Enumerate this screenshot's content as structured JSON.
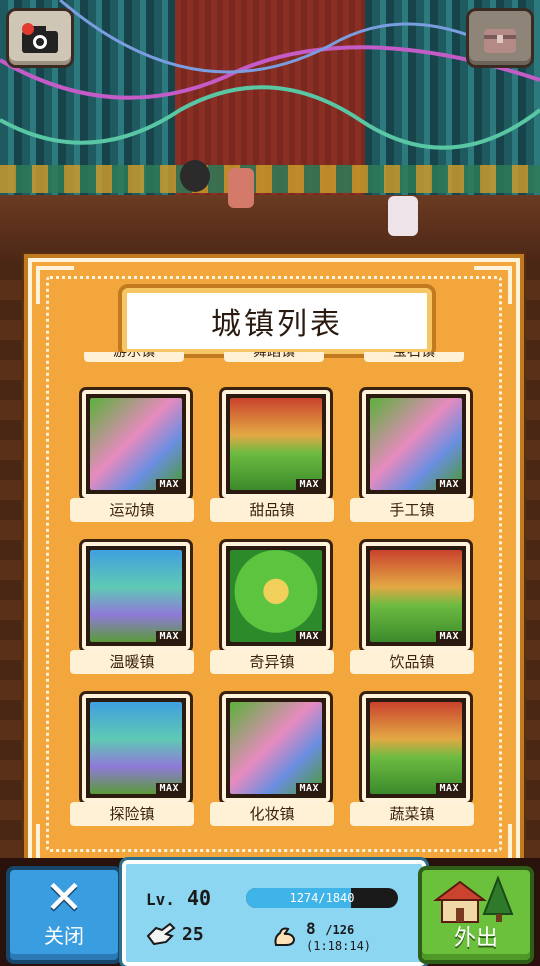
{
  "header": {
    "camera_button_icon": "camera-icon",
    "chest_button_icon": "treasure-chest-icon"
  },
  "panel": {
    "title": "城镇列表",
    "cut_off_row": [
      "游乐镇",
      "舞蹈镇",
      "宝石镇"
    ],
    "max_badge": "MAX",
    "towns": [
      {
        "name": "运动镇",
        "theme": "sports-town",
        "max": true
      },
      {
        "name": "甜品镇",
        "theme": "dessert-town",
        "max": true
      },
      {
        "name": "手工镇",
        "theme": "craft-town",
        "max": true
      },
      {
        "name": "温暖镇",
        "theme": "warm-town",
        "max": true
      },
      {
        "name": "奇异镇",
        "theme": "strange-town",
        "max": true
      },
      {
        "name": "饮品镇",
        "theme": "drinks-town",
        "max": true
      },
      {
        "name": "探险镇",
        "theme": "adventure-town",
        "max": true
      },
      {
        "name": "化妆镇",
        "theme": "makeup-town",
        "max": true
      },
      {
        "name": "蔬菜镇",
        "theme": "vegetable-town",
        "max": true
      }
    ]
  },
  "status": {
    "level_prefix": "Lv.",
    "level": "40",
    "xp_text": "1274/1840",
    "xp_fraction": 0.692,
    "hearts": "25",
    "stamina": "8",
    "stamina_max": "/126",
    "stamina_timer": "(1:18:14)"
  },
  "buttons": {
    "close_label": "关闭",
    "go_out_label": "外出"
  },
  "colors": {
    "panel_orange": "#f2a63c",
    "panel_border": "#fff3dc",
    "close_blue": "#3a9de0",
    "go_green": "#6cc13c",
    "status_blue": "#8cd6f2"
  }
}
